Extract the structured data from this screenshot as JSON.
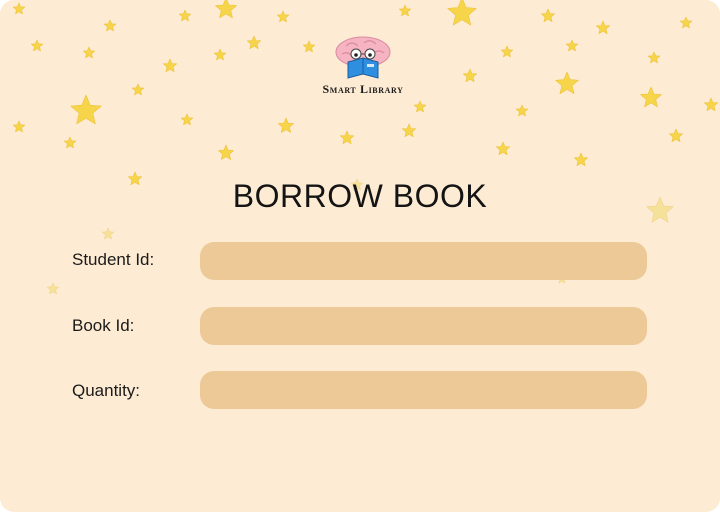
{
  "brand": {
    "name": "Smart Library"
  },
  "page": {
    "title": "BORROW BOOK"
  },
  "form": {
    "fields": [
      {
        "label": "Student Id:",
        "value": "",
        "placeholder": ""
      },
      {
        "label": "Book Id:",
        "value": "",
        "placeholder": ""
      },
      {
        "label": "Quantity:",
        "value": "",
        "placeholder": ""
      }
    ]
  },
  "colors": {
    "background": "#FDEBD3",
    "input_fill": "#EDC998",
    "star": "#F7D54A",
    "star_faded": "#F6E19A"
  },
  "icons": {
    "logo": "brain-reading-book-icon",
    "decor": "star-icon"
  }
}
